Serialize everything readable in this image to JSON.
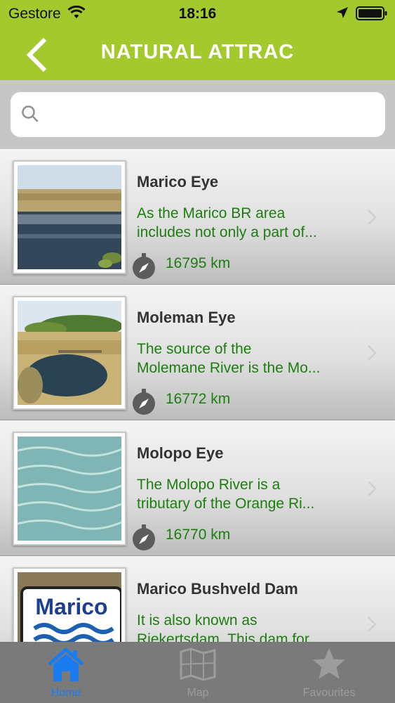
{
  "status_bar": {
    "carrier": "Gestore",
    "time": "18:16"
  },
  "header": {
    "title": "NATURAL ATTRAC",
    "back_icon": "chevron-left-icon",
    "background_color": "#a3c92c"
  },
  "search": {
    "placeholder": "",
    "value": "",
    "icon": "search-icon"
  },
  "attractions": [
    {
      "name": "Marico Eye",
      "desc_line1": "As the Marico BR area",
      "desc_line2": "includes not only a part of...",
      "distance": "16795 km"
    },
    {
      "name": "Moleman Eye",
      "desc_line1": "The source of the",
      "desc_line2": "Molemane River is the Mo...",
      "distance": "16772 km"
    },
    {
      "name": "Molopo Eye",
      "desc_line1": "The Molopo River is a",
      "desc_line2": "tributary of the Orange Ri...",
      "distance": "16770 km"
    },
    {
      "name": "Marico Bushveld Dam",
      "desc_line1": "It is also known as",
      "desc_line2": "Riekertsdam. This dam for...",
      "distance": "",
      "sign_text": "Marico"
    }
  ],
  "tabbar": {
    "tabs": [
      {
        "label": "Home",
        "icon": "home-icon",
        "active": true
      },
      {
        "label": "Map",
        "icon": "map-icon",
        "active": false
      },
      {
        "label": "Favourites",
        "icon": "star-icon",
        "active": false
      }
    ],
    "active_color": "#1b7cf0"
  },
  "colors": {
    "accent": "#a3c92c",
    "description_text": "#1d7d10"
  }
}
